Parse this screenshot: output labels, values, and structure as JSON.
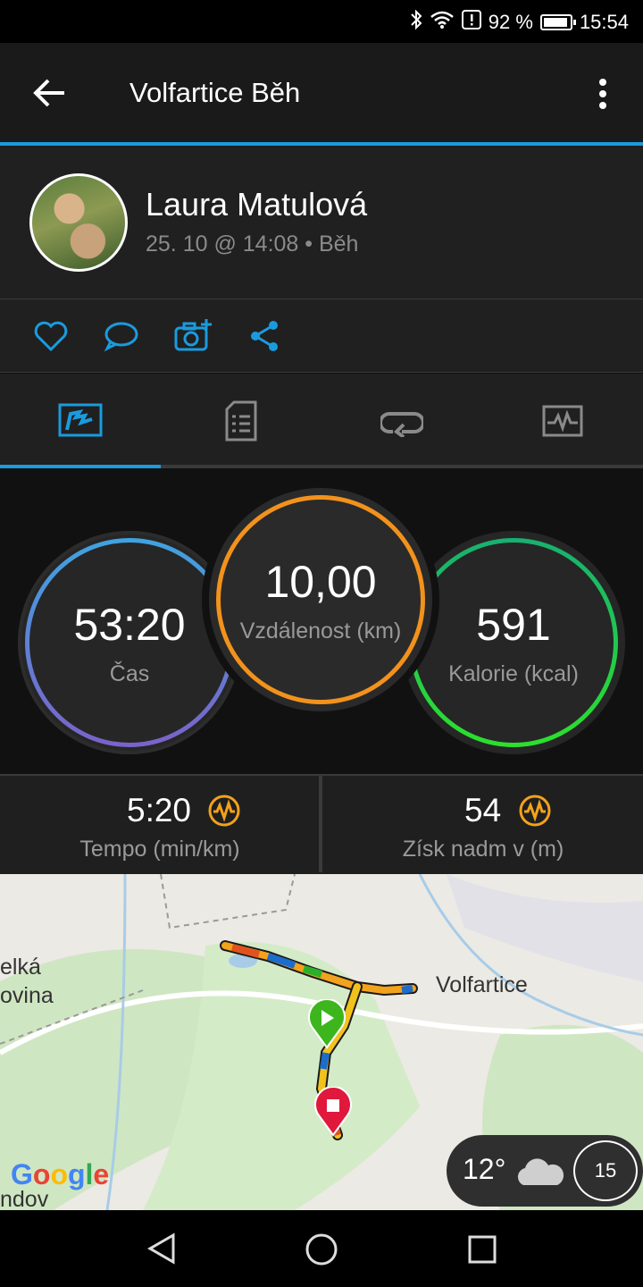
{
  "status_bar": {
    "battery": "92 %",
    "time": "15:54"
  },
  "app_bar": {
    "title": "Volfartice Běh"
  },
  "profile": {
    "name": "Laura Matulová",
    "meta": "25. 10 @ 14:08 • Běh"
  },
  "actions": [
    "like-icon",
    "comment-icon",
    "add-photo-icon",
    "share-icon"
  ],
  "tabs": {
    "active_index": 0,
    "icons": [
      "overview-icon",
      "details-icon",
      "laps-icon",
      "charts-icon"
    ]
  },
  "stats": {
    "time": {
      "value": "53:20",
      "label": "Čas"
    },
    "distance": {
      "value": "10,00",
      "label": "Vzdálenost (km)"
    },
    "calories": {
      "value": "591",
      "label": "Kalorie (kcal)"
    }
  },
  "cells": {
    "pace": {
      "value": "5:20",
      "label": "Tempo (min/km)"
    },
    "elevation": {
      "value": "54",
      "label": "Získ nadm v (m)"
    }
  },
  "map": {
    "labels": {
      "town": "Volfartice",
      "left_top": "elká",
      "left_bottom": "ovina",
      "bottom_left": "ndov"
    },
    "google": "Google",
    "weather": {
      "temp": "12°",
      "wind": "15"
    }
  },
  "colors": {
    "accent": "#1a9bde",
    "distance_ring": "#f2921c",
    "calorie_ring": "#2ce02c",
    "chart_icon": "#f2a21c"
  }
}
